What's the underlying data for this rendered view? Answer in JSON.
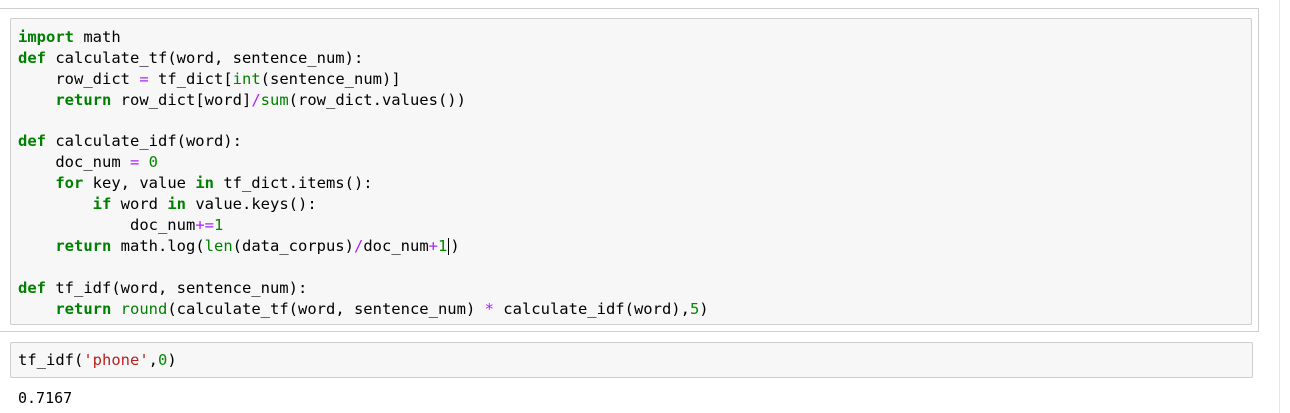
{
  "cell1": {
    "lines": [
      [
        {
          "t": "import",
          "c": "kw"
        },
        {
          "t": " math"
        }
      ],
      [
        {
          "t": "def",
          "c": "kw"
        },
        {
          "t": " calculate_tf(word, sentence_num):"
        }
      ],
      [
        {
          "t": "    row_dict "
        },
        {
          "t": "=",
          "c": "op"
        },
        {
          "t": " tf_dict[",
          "c": ""
        },
        {
          "t": "int",
          "c": "bi"
        },
        {
          "t": "(sentence_num)]"
        }
      ],
      [
        {
          "t": "    "
        },
        {
          "t": "return",
          "c": "kw"
        },
        {
          "t": " row_dict[word]"
        },
        {
          "t": "/",
          "c": "op"
        },
        {
          "t": "sum",
          "c": "bi"
        },
        {
          "t": "(row_dict.values())"
        }
      ],
      [
        {
          "t": ""
        }
      ],
      [
        {
          "t": "def",
          "c": "kw"
        },
        {
          "t": " calculate_idf(word):"
        }
      ],
      [
        {
          "t": "    doc_num "
        },
        {
          "t": "=",
          "c": "op"
        },
        {
          "t": " "
        },
        {
          "t": "0",
          "c": "num"
        }
      ],
      [
        {
          "t": "    "
        },
        {
          "t": "for",
          "c": "kw"
        },
        {
          "t": " key, value "
        },
        {
          "t": "in",
          "c": "kw"
        },
        {
          "t": " tf_dict.items():"
        }
      ],
      [
        {
          "t": "        "
        },
        {
          "t": "if",
          "c": "kw"
        },
        {
          "t": " word "
        },
        {
          "t": "in",
          "c": "kw"
        },
        {
          "t": " value.keys():"
        }
      ],
      [
        {
          "t": "            doc_num"
        },
        {
          "t": "+=",
          "c": "op"
        },
        {
          "t": "1",
          "c": "num"
        }
      ],
      [
        {
          "t": "    "
        },
        {
          "t": "return",
          "c": "kw"
        },
        {
          "t": " math.log("
        },
        {
          "t": "len",
          "c": "bi"
        },
        {
          "t": "(data_corpus)"
        },
        {
          "t": "/",
          "c": "op"
        },
        {
          "t": "doc_num"
        },
        {
          "t": "+",
          "c": "op"
        },
        {
          "t": "1",
          "c": "num"
        },
        {
          "t": "",
          "cursor": true
        },
        {
          "t": ")"
        }
      ],
      [
        {
          "t": ""
        }
      ],
      [
        {
          "t": "def",
          "c": "kw"
        },
        {
          "t": " tf_idf(word, sentence_num):"
        }
      ],
      [
        {
          "t": "    "
        },
        {
          "t": "return",
          "c": "kw"
        },
        {
          "t": " "
        },
        {
          "t": "round",
          "c": "bi"
        },
        {
          "t": "(calculate_tf(word, sentence_num) "
        },
        {
          "t": "*",
          "c": "op"
        },
        {
          "t": " calculate_idf(word),"
        },
        {
          "t": "5",
          "c": "num"
        },
        {
          "t": ")"
        }
      ]
    ]
  },
  "cell2": {
    "line": [
      {
        "t": "tf_idf("
      },
      {
        "t": "'phone'",
        "c": "str"
      },
      {
        "t": ","
      },
      {
        "t": "0",
        "c": "num"
      },
      {
        "t": ")"
      }
    ]
  },
  "output": {
    "text": "0.7167"
  }
}
